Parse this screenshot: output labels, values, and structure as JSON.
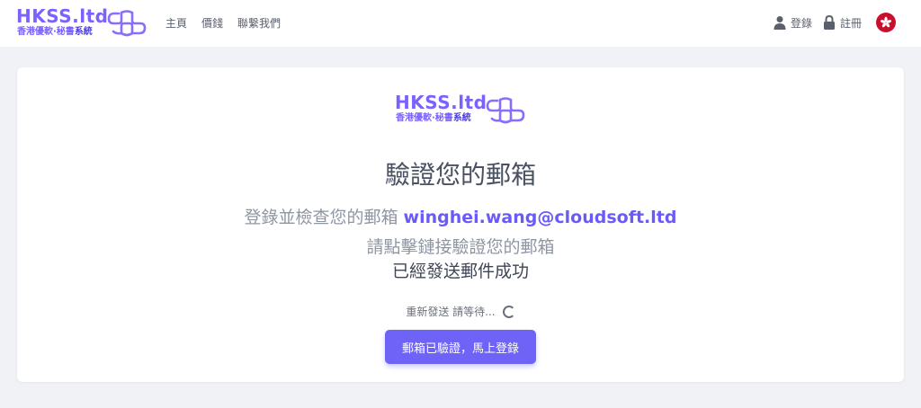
{
  "header": {
    "brand": {
      "name": "HKSS.ltd",
      "sub_plain": "香港優軟·秘書",
      "sub_strong": "系統"
    },
    "nav": [
      {
        "label": "主頁"
      },
      {
        "label": "價錢"
      },
      {
        "label": "聯繫我們"
      }
    ],
    "login_label": "登錄",
    "register_label": "註冊"
  },
  "card": {
    "brand": {
      "name": "HKSS.ltd",
      "sub_plain": "香港優軟·秘書",
      "sub_strong": "系統"
    },
    "title": "驗證您的郵箱",
    "line1_prefix": "登錄並檢查您的郵箱",
    "email": "winghei.wang@cloudsoft.ltd",
    "line2": "請點擊鏈接驗證您的郵箱",
    "line3": "已經發送郵件成功",
    "resend_text": "重新發送 請等待...",
    "verify_button": "郵箱已驗證，馬上登錄"
  },
  "colors": {
    "accent": "#6f63f7",
    "brand": "#7b61ff",
    "flag": "#c8102e"
  }
}
